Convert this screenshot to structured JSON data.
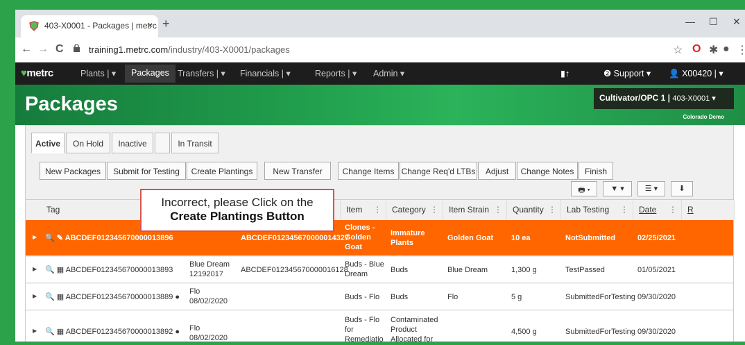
{
  "browser": {
    "tab_title": "403-X0001 - Packages | metrc",
    "tab_close": "×",
    "new_tab": "+",
    "url_host": "training1.metrc.com",
    "url_path": "/industry/403-X0001/packages",
    "back": "←",
    "forward": "→",
    "reload": "C",
    "minimize": "—",
    "maximize": "☐",
    "close": "✕"
  },
  "nav": {
    "logo": "metrc",
    "items": [
      "Plants | ▾",
      "Packages",
      "Transfers | ▾",
      "Financials | ▾",
      "Reports | ▾",
      "Admin ▾"
    ],
    "support": "❷ Support ▾",
    "user": "X00420 | ▾"
  },
  "banner": {
    "title": "Packages",
    "facility": "Cultivator/OPC 1 | ",
    "license": "403-X0001 ▾",
    "state": "Colorado Demo"
  },
  "tabs": [
    "Active",
    "On Hold",
    "Inactive",
    "",
    "In Transit"
  ],
  "toolbar": [
    "New Packages",
    "Submit for Testing",
    "Create Plantings",
    "New Transfer",
    "Change Items",
    "Change Req'd LTBs",
    "Adjust",
    "Change Notes",
    "Finish"
  ],
  "toolbar_icons": [
    "🖶 ▾",
    "▼ ▾",
    "☰ ▾",
    "⬇"
  ],
  "columns": [
    "Tag",
    "",
    "",
    "Item",
    "Category",
    "Item Strain",
    "Quantity",
    "Lab Testing",
    "Date",
    "R"
  ],
  "rows": [
    {
      "tag": "ABCDEF012345670000013896",
      "strain_date": "",
      "source": "ABCDEF012345670000014327",
      "item": "Clones - Golden Goat",
      "category": "Immature Plants",
      "item_strain": "Golden Goat",
      "quantity": "10 ea",
      "lab": "NotSubmitted",
      "date": "02/25/2021"
    },
    {
      "tag": "ABCDEF012345670000013893",
      "strain_date": "Blue Dream 12192017",
      "source": "ABCDEF012345670000016128",
      "item": "Buds - Blue Dream",
      "category": "Buds",
      "item_strain": "Blue Dream",
      "quantity": "1,300 g",
      "lab": "TestPassed",
      "date": "01/05/2021"
    },
    {
      "tag": "ABCDEF012345670000013889",
      "strain_date": "Flo 08/02/2020",
      "source": "",
      "item": "Buds - Flo",
      "category": "Buds",
      "item_strain": "Flo",
      "quantity": "5 g",
      "lab": "SubmittedForTesting",
      "date": "09/30/2020"
    },
    {
      "tag": "ABCDEF012345670000013892",
      "strain_date": "Flo 08/02/2020",
      "source": "",
      "item": "Buds - Flo for Remediation",
      "category": "Contaminated Product Allocated for",
      "item_strain": "",
      "quantity": "4,500 g",
      "lab": "SubmittedForTesting",
      "date": "09/30/2020"
    }
  ],
  "callout": {
    "line1": "Incorrect, please Click on the",
    "line2": "Create Plantings Button"
  },
  "colors": {
    "selected_row": "#ff6600",
    "frame": "#2ca24a"
  }
}
